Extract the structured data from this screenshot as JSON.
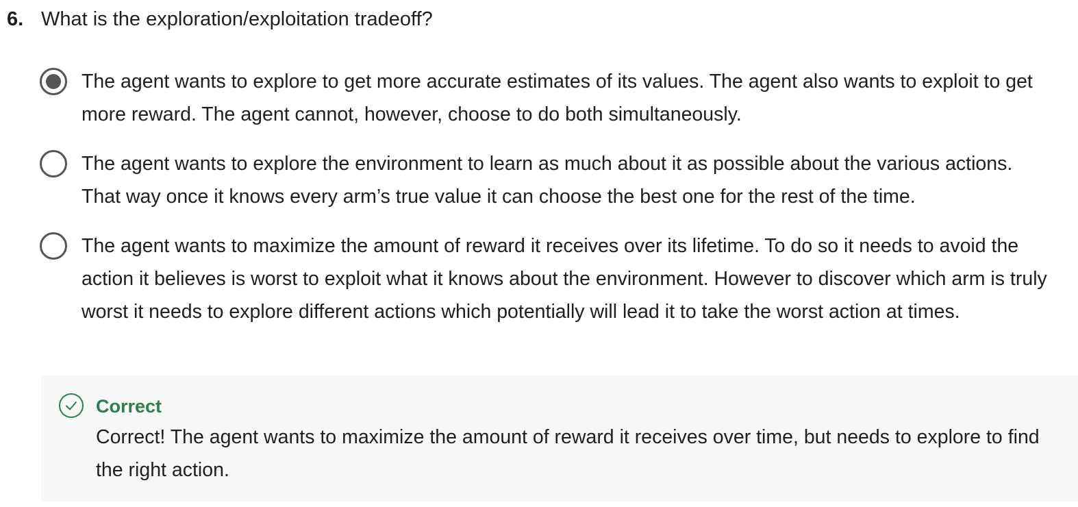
{
  "question": {
    "number": "6.",
    "text": "What is the exploration/exploitation tradeoff?"
  },
  "options": [
    {
      "label": "The agent wants to explore to get more accurate estimates of its values. The agent also wants to exploit to get more reward. The agent cannot, however, choose to do both simultaneously.",
      "selected": true
    },
    {
      "label": "The agent wants to explore the environment to learn as much about it as possible about the various actions. That way once it knows every arm’s true value it can choose the best one for the rest of the time.",
      "selected": false
    },
    {
      "label": "The agent wants to maximize the amount of reward it receives over its lifetime. To do so it needs to avoid the action it believes is worst to exploit what it knows about the environment. However to discover which arm is truly worst it needs to explore different actions which potentially will lead it to take the worst action at times.",
      "selected": false
    }
  ],
  "feedback": {
    "icon": "check-circle-icon",
    "status": "Correct",
    "status_color": "#2e7d4f",
    "message": "Correct! The agent wants to maximize the amount of reward it receives over time, but needs to explore to find the right action."
  }
}
